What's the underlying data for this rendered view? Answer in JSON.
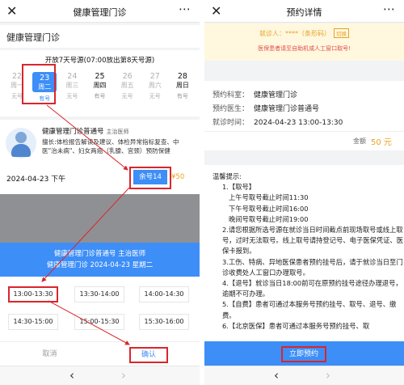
{
  "left": {
    "title": "健康管理门诊",
    "dept_name": "健康管理门诊",
    "schedule_note": "开放7天号源(07:00放出第8天号源)",
    "days": [
      {
        "date": "22",
        "weekday": "周一",
        "status": "无号"
      },
      {
        "date": "23",
        "weekday": "周二",
        "status": "有号"
      },
      {
        "date": "24",
        "weekday": "周三",
        "status": "无号"
      },
      {
        "date": "25",
        "weekday": "周四",
        "status": "有号"
      },
      {
        "date": "26",
        "weekday": "周五",
        "status": "无号"
      },
      {
        "date": "27",
        "weekday": "周六",
        "status": "无号"
      },
      {
        "date": "28",
        "weekday": "周日",
        "status": "有号"
      }
    ],
    "doctor": {
      "name": "健康管理门诊普通号",
      "title": "主治医师",
      "description": "擅长:体检报告解读及建议、体检异常指标复查、中医\"治未病\"、妇女两癌（乳腺、宫颈）预防保健"
    },
    "slot_date": "2024-04-23 下午",
    "remaining": "余号14",
    "price": "¥50",
    "sheet": {
      "line1": "健康管理门诊普通号 主治医师",
      "line2": "健康管理门诊 2024-04-23 星期二"
    },
    "time_slots": [
      "13:00-13:30",
      "13:30-14:00",
      "14:00-14:30",
      "14:30-15:00",
      "15:00-15:30",
      "15:30-16:00"
    ],
    "cancel_label": "取消",
    "confirm_label": "确认"
  },
  "right": {
    "title": "预约详情",
    "patient_line": "就诊人：****（条形码）",
    "switch_label": "切换",
    "insurance_note": "医保患者请至自助机或人工窗口取号!",
    "rows": [
      {
        "label": "预约科室：",
        "value": "健康管理门诊"
      },
      {
        "label": "预约医生：",
        "value": "健康管理门诊普通号"
      },
      {
        "label": "就诊时间：",
        "value": "2024-04-23 13:00-13:30"
      }
    ],
    "amount_label": "金额",
    "amount_value": "50 元",
    "tips_title": "温馨提示:",
    "tips": [
      {
        "kind": "i",
        "text": "1.【取号】"
      },
      {
        "kind": "i2",
        "text": "上午号取号截止时间11:30"
      },
      {
        "kind": "i2",
        "text": "下午号取号截止时间16:00"
      },
      {
        "kind": "i2",
        "text": "晚间号取号截止时间19:00"
      },
      {
        "kind": "i",
        "text": "2.请您根据所选号源在就诊当日时间截点前现场取号或线上取号，过时无法取号。线上取号请持登记号、电子医保凭证、医保卡报到。"
      },
      {
        "kind": "i",
        "text": "3.工伤、特病、异地医保患者预约挂号后，请于就诊当日至门诊收费处人工窗口办理取号。"
      },
      {
        "kind": "i",
        "text": "4.【退号】就诊当日18:00前可在原预约挂号途径办理退号，逾期不可办理。"
      },
      {
        "kind": "i",
        "text": "5.【自费】患者可通过本服务号预约挂号、取号、退号、缴费。"
      },
      {
        "kind": "i",
        "text": "6.【北京医保】患者可通过本服务号预约挂号、取"
      }
    ],
    "submit_label": "立即预约"
  },
  "nav": {
    "back_icon": "‹",
    "forward_icon": "›"
  },
  "colors": {
    "accent": "#3d8ef7",
    "highlight_red": "#d9262c",
    "price_orange": "#f0a020",
    "notice_bg": "#fff8de"
  }
}
